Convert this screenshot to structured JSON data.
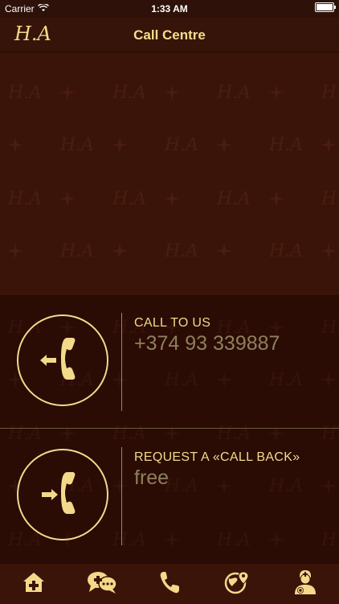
{
  "status_bar": {
    "carrier": "Carrier",
    "time": "1:33 AM"
  },
  "nav": {
    "logo": "H.A",
    "title": "Call Centre"
  },
  "contacts": [
    {
      "title": "CALL TO US",
      "value": "+374 93 339887",
      "icon": "phone-outgoing-icon"
    },
    {
      "title": "REQUEST A «CALL BACK»",
      "value": "free",
      "icon": "phone-incoming-icon"
    }
  ],
  "tabs": [
    {
      "name": "home-medical-icon"
    },
    {
      "name": "chat-medical-icon"
    },
    {
      "name": "phone-icon"
    },
    {
      "name": "globe-location-icon"
    },
    {
      "name": "doctor-settings-icon"
    }
  ],
  "colors": {
    "accent": "#f3d98a",
    "background": "#2a0d05",
    "value_text": "#8f7f5c"
  }
}
